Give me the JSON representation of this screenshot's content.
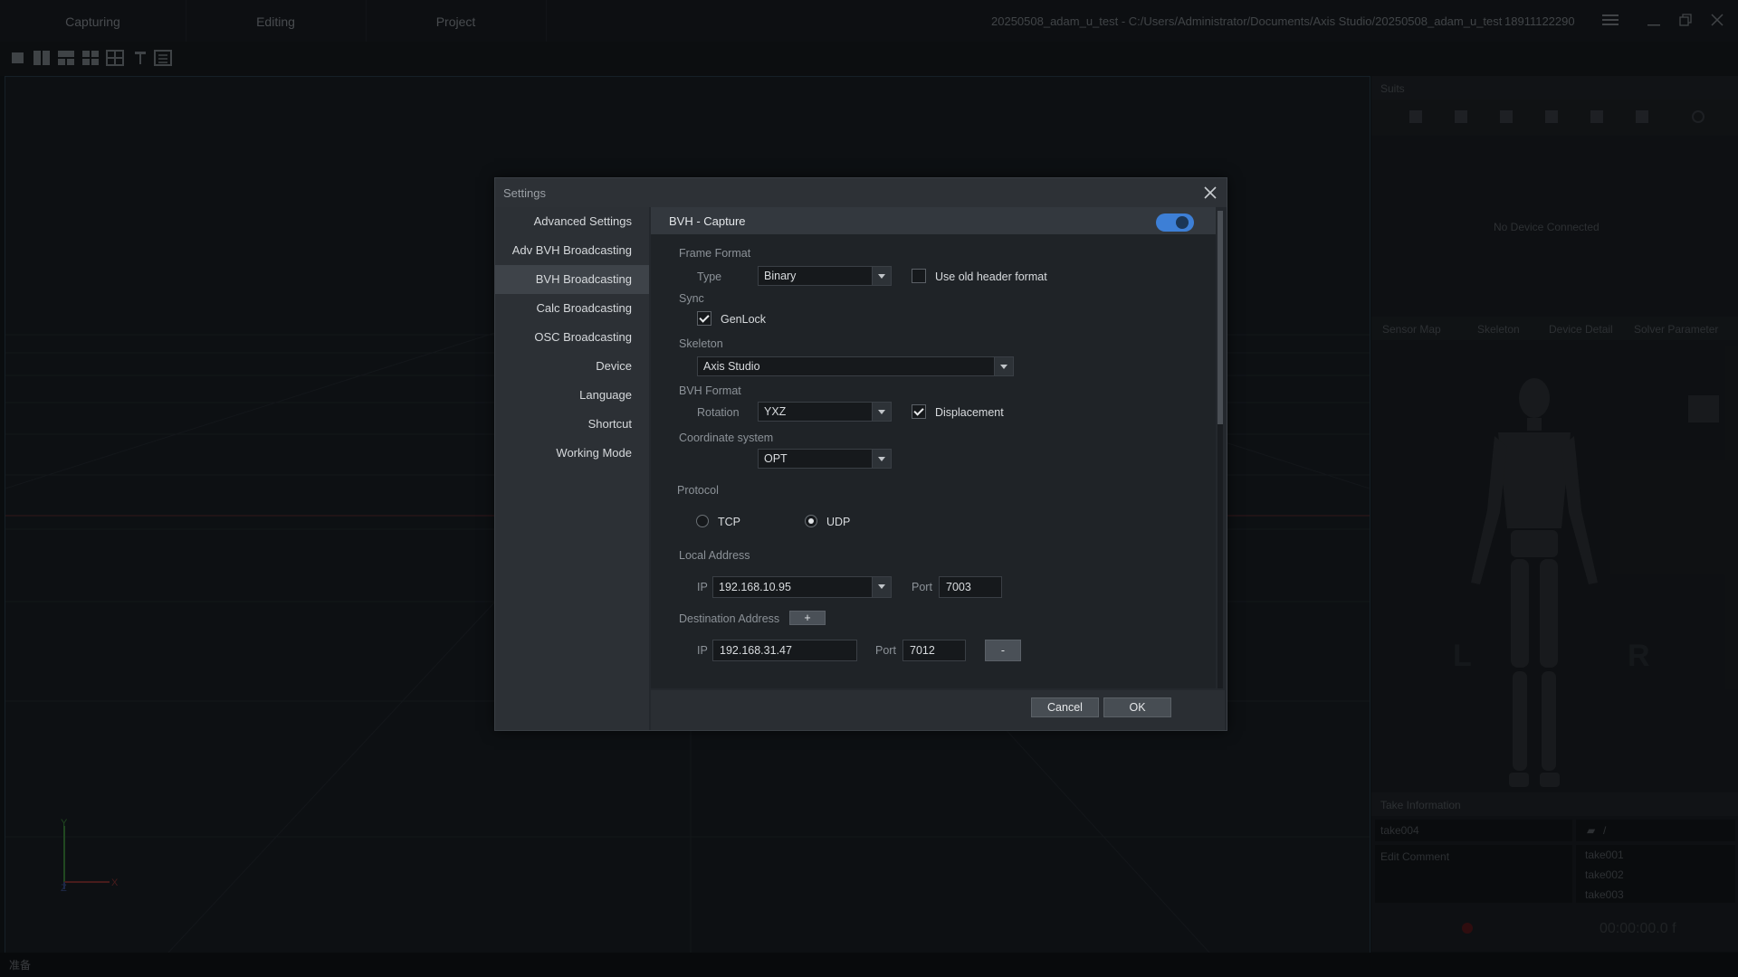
{
  "app": {
    "tabs": [
      "Capturing",
      "Editing",
      "Project"
    ],
    "path": "20250508_adam_u_test - C:/Users/Administrator/Documents/Axis Studio/20250508_adam_u_test",
    "account": "18911122290",
    "status": "准备"
  },
  "right_panel": {
    "title": "Suits",
    "no_device": "No Device Connected",
    "tabs": [
      "Sensor Map",
      "Skeleton",
      "Device Detail",
      "Solver Parameter"
    ],
    "body_left": "L",
    "body_right": "R",
    "take_info_title": "Take Information",
    "take_name": "take004",
    "folder_path": "/",
    "comment_placeholder": "Edit Comment",
    "takes": [
      "take001",
      "take002",
      "take003"
    ],
    "timecode": "00:00:00.0 f"
  },
  "dialog": {
    "title": "Settings",
    "nav": [
      "Advanced Settings",
      "Adv BVH Broadcasting",
      "BVH Broadcasting",
      "Calc Broadcasting",
      "OSC Broadcasting",
      "Device",
      "Language",
      "Shortcut",
      "Working Mode"
    ],
    "active_nav": "BVH Broadcasting",
    "section_title": "BVH - Capture",
    "enabled": true,
    "frame_format": {
      "heading": "Frame Format",
      "type_label": "Type",
      "type_value": "Binary",
      "old_header_label": "Use old header format",
      "old_header_checked": false
    },
    "sync": {
      "heading": "Sync",
      "genlock_label": "GenLock",
      "genlock_checked": true
    },
    "skeleton": {
      "heading": "Skeleton",
      "value": "Axis Studio"
    },
    "bvh_format": {
      "heading": "BVH Format",
      "rotation_label": "Rotation",
      "rotation_value": "YXZ",
      "displacement_label": "Displacement",
      "displacement_checked": true
    },
    "coordinate": {
      "heading": "Coordinate system",
      "value": "OPT"
    },
    "protocol": {
      "heading": "Protocol",
      "tcp_label": "TCP",
      "udp_label": "UDP",
      "selected": "UDP"
    },
    "local_address": {
      "heading": "Local Address",
      "ip_label": "IP",
      "ip_value": "192.168.10.95",
      "port_label": "Port",
      "port_value": "7003"
    },
    "destination": {
      "heading": "Destination Address",
      "add_label": "+",
      "ip_label": "IP",
      "ip_value": "192.168.31.47",
      "port_label": "Port",
      "port_value": "7012",
      "remove_label": "-"
    },
    "cancel_label": "Cancel",
    "ok_label": "OK"
  },
  "colors": {
    "accent": "#3d7fd6",
    "background": "#15191e"
  }
}
